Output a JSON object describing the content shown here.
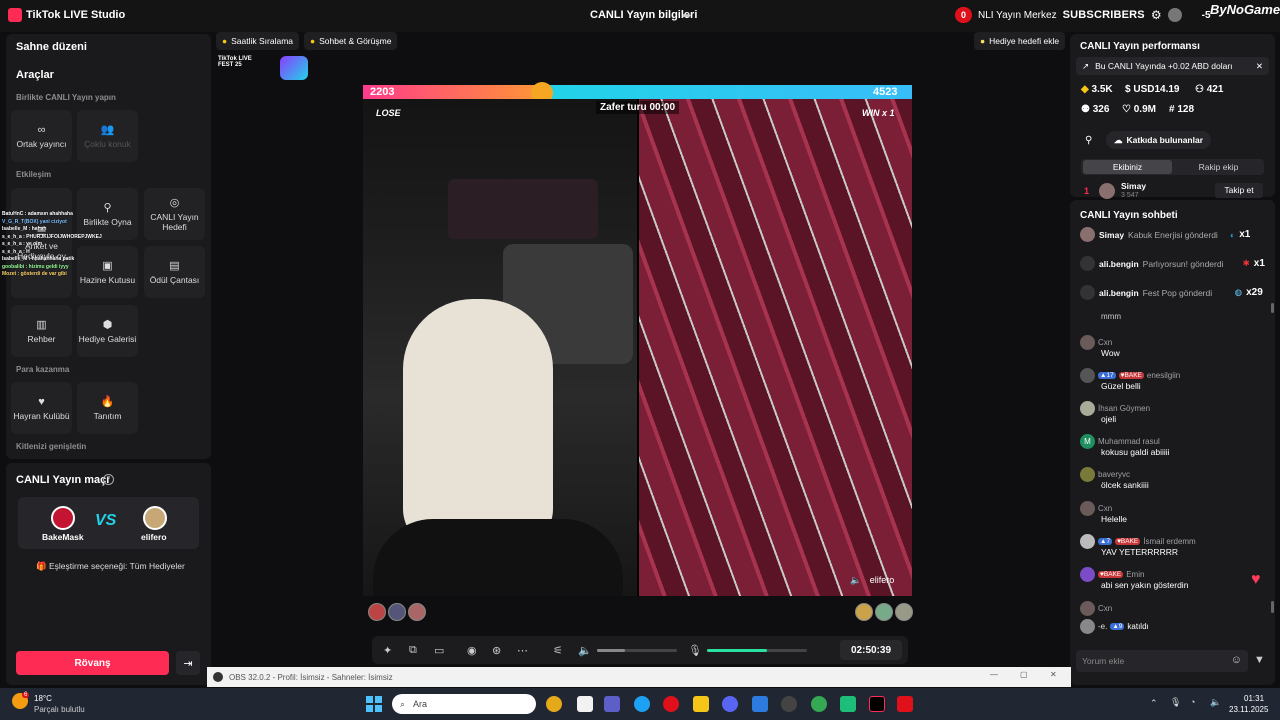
{
  "titlebar": {
    "app_name": "TikTok LIVE Studio",
    "center_title": "CANLI Yayın bilgileri",
    "notif_count": "0",
    "live_center": "NLI Yayın Merkez",
    "subscribers": "SUBSCRIBERS",
    "count_small": "-5",
    "brand": "ByNoGame"
  },
  "left": {
    "scene_title": "Sahne düzeni",
    "tools_title": "Araçlar",
    "together_label": "Birlikte CANLI Yayın yapın",
    "co_host": "Ortak yayıncı",
    "multi_guest": "Çoklu konuk",
    "interaction_label": "Etkileşim",
    "poll": "Anket ve Hediyeyle oy",
    "play_together": "Birlikte Oyna",
    "live_goal": "CANLI Yayın Hedefi",
    "treasure": "Hazine Kutusu",
    "reward_bag": "Ödül Çantası",
    "guide": "Rehber",
    "gift_gallery": "Hediye Galerisi",
    "monetize_label": "Para kazanma",
    "fan_club": "Hayran Kulübü",
    "promo": "Tanıtım",
    "expand_label": "Kitlenizi genişletin",
    "match_title": "CANLI Yayın maçı",
    "player1": "BakeMask",
    "player2": "elifero",
    "vs": "VS",
    "match_option": "Eşleştirme seçeneği: Tüm Hediyeler",
    "rematch": "Rövanş",
    "chat_overlay": [
      "BatuHnC : adamsın ahahhaha",
      "V_G_R_T(BOX) yani ciziyot",
      "İsabelle_M : hahah",
      "s_e_h_a : PHURJKIJFOIJWHOREPJWKEJ",
      "s_e_h_a : ye olm",
      "s_e_h_a : H",
      "İsabelle_M : hhahahhaha patik",
      "goobalibi : hizimu geldi iyyy",
      "Mozet : gösterdi de var gibi"
    ]
  },
  "center": {
    "pill_hourly": "Saatlik Sıralama",
    "pill_chat": "Sohbet & Görüşme",
    "pill_gift_goal": "Hediye hedefi ekle",
    "live_fest": "TikTok LIVE FEST 25",
    "score_left": "2203",
    "score_right": "4523",
    "victory": "Zafer turu 00:00",
    "lose": "LOSE",
    "win": "WIN x 1",
    "right_streamer": "elifero",
    "timer": "02:50:39",
    "volume_level": 0.35,
    "mic_level": 0.6
  },
  "right": {
    "perf_title": "CANLI Yayın performansı",
    "earn_note": "Bu CANLI Yayında +0.02 ABD doları",
    "stats": {
      "diamonds": "3.5K",
      "usd": "USD14.19",
      "viewers": "421",
      "followers": "326",
      "likes": "0.9M",
      "shares": "128"
    },
    "contributors": "Katkıda bulunanlar",
    "tab_team": "Ekibiniz",
    "tab_opponent": "Rakip ekip",
    "top_rank": "1",
    "top_user": "Simay",
    "top_sub": "3  547",
    "follow_btn": "Takip et",
    "chat_title": "CANLI Yayın sohbeti",
    "gifts": [
      {
        "user": "Simay",
        "text": "Kabuk Enerjisi gönderdi",
        "count": "x1"
      },
      {
        "user": "ali.bengin",
        "text": "Parlıyorsun! gönderdi",
        "count": "x1"
      },
      {
        "user": "ali.bengin",
        "text": "Fest Pop gönderdi",
        "count": "x29"
      }
    ],
    "truncated_top": "mmm",
    "messages": [
      {
        "name": "Cxn",
        "msg": "Wow",
        "level": "",
        "bake": false
      },
      {
        "name": "enesilgiin",
        "msg": "Güzel belli",
        "level": "17",
        "bake": true
      },
      {
        "name": "İhsan Göymen",
        "msg": "ojeli",
        "level": "",
        "bake": false
      },
      {
        "name": "Muhammad rasul",
        "msg": "kokusu galdi abiiiii",
        "level": "",
        "bake": false
      },
      {
        "name": "baveryvc",
        "msg": "ölcek sankiiii",
        "level": "",
        "bake": false
      },
      {
        "name": "Cxn",
        "msg": "Helelle",
        "level": "",
        "bake": false
      },
      {
        "name": "İsmail erdemm",
        "msg": "YAV YETERRRRRR",
        "level": "7",
        "bake": true
      },
      {
        "name": "Emin",
        "msg": "abi sen yakın gösterdin",
        "level": "",
        "bake": true
      },
      {
        "name": "Cxn",
        "msg": "",
        "level": "",
        "bake": false
      }
    ],
    "joined_level": "9",
    "joined_text": "katıldı",
    "joined_prefix": "-e.",
    "comment_placeholder": "Yorum ekle",
    "bake_label": "BAKE"
  },
  "obs": {
    "label": "OBS 32.0.2 - Profil: İsimsiz - Sahneler: İsimsiz"
  },
  "taskbar": {
    "weather_temp": "18°C",
    "weather_desc": "Parçalı bulutlu",
    "weather_badge": "6",
    "search_placeholder": "Ara",
    "time": "01:31",
    "date": "23.11.2025"
  },
  "colors": {
    "accent": "#fe2c55",
    "win_bar": "#22d3e8",
    "panel_bg": "#1a1a1c"
  }
}
